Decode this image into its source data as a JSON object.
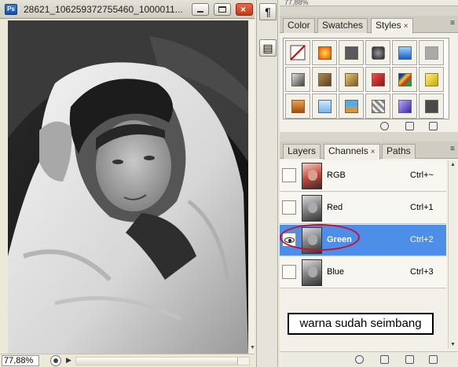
{
  "document": {
    "title": "28621_106259372755460_1000011...",
    "app_icon_label": "Ps",
    "zoom": "77,88%"
  },
  "dock": {
    "paragraph_glyph": "¶",
    "navigator_glyph": "▤"
  },
  "top_edge_text": "77,88%",
  "styles_panel": {
    "tabs": [
      {
        "label": "Color",
        "active": false
      },
      {
        "label": "Swatches",
        "active": false
      },
      {
        "label": "Styles",
        "active": true,
        "close": "×"
      }
    ],
    "swatch_icons": [
      "none-style-icon",
      "orange-glow-icon",
      "gray-button-icon",
      "dark-gloss-icon",
      "blue-glass-icon",
      "gray-flat-icon",
      "gray-bevel-icon",
      "brown-bevel-icon",
      "gold-bevel-icon",
      "red-bevel-icon",
      "rainbow-stripe-icon",
      "yellow-puzzle-icon",
      "copper-icon",
      "light-blue-icon",
      "sky-landscape-icon",
      "chrome-icon",
      "purple-glass-icon",
      "dark-gray-icon"
    ]
  },
  "layers_panel": {
    "tabs": [
      {
        "label": "Layers",
        "active": false
      },
      {
        "label": "Channels",
        "active": true,
        "close": "×"
      },
      {
        "label": "Paths",
        "active": false
      }
    ],
    "channels": [
      {
        "name": "RGB",
        "shortcut": "Ctrl+~",
        "visible": false,
        "selected": false
      },
      {
        "name": "Red",
        "shortcut": "Ctrl+1",
        "visible": false,
        "selected": false
      },
      {
        "name": "Green",
        "shortcut": "Ctrl+2",
        "visible": true,
        "selected": true
      },
      {
        "name": "Blue",
        "shortcut": "Ctrl+3",
        "visible": false,
        "selected": false
      }
    ]
  },
  "annotation": "warna sudah seimbang",
  "colors": {
    "selection": "#4d8ee8",
    "highlight_ellipse": "#c8102e"
  }
}
